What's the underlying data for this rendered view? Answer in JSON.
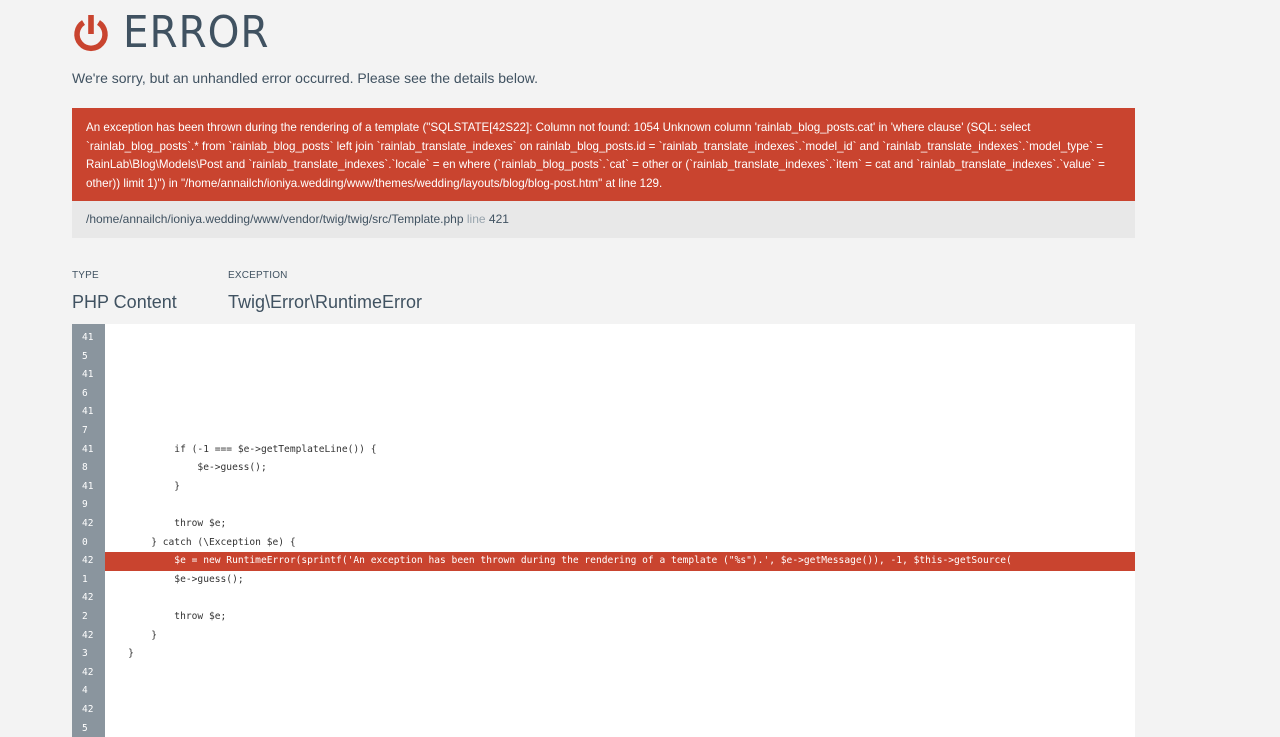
{
  "header": {
    "title": "ERROR",
    "icon": "power-icon",
    "accent_color": "#c9442f"
  },
  "subtitle": "We're sorry, but an unhandled error occurred. Please see the details below.",
  "error_message": "An exception has been thrown during the rendering of a template (\"SQLSTATE[42S22]: Column not found: 1054 Unknown column 'rainlab_blog_posts.cat' in 'where clause' (SQL: select `rainlab_blog_posts`.* from `rainlab_blog_posts` left join `rainlab_translate_indexes` on rainlab_blog_posts.id = `rainlab_translate_indexes`.`model_id` and `rainlab_translate_indexes`.`model_type` = RainLab\\Blog\\Models\\Post and `rainlab_translate_indexes`.`locale` = en where (`rainlab_blog_posts`.`cat` = other or (`rainlab_translate_indexes`.`item` = cat and `rainlab_translate_indexes`.`value` = other)) limit 1)\") in \"/home/annailch/ioniya.wedding/www/themes/wedding/layouts/blog/blog-post.htm\" at line 129.",
  "file": {
    "path": "/home/annailch/ioniya.wedding/www/vendor/twig/twig/src/Template.php",
    "line_label": "line",
    "line_number": "421"
  },
  "meta": {
    "type_label": "TYPE",
    "type_value": "PHP Content",
    "exception_label": "EXCEPTION",
    "exception_value": "Twig\\Error\\RuntimeError"
  },
  "code": {
    "gutter": [
      "41",
      "5",
      "41",
      "6",
      "41",
      "7",
      "41",
      "8",
      "41",
      "9",
      "42",
      "0",
      "42",
      "1",
      "42",
      "2",
      "42",
      "3",
      "42",
      "4",
      "42",
      "5"
    ],
    "lines": [
      "",
      "",
      "",
      "",
      "",
      "",
      "            if (-1 === $e->getTemplateLine()) {",
      "                $e->guess();",
      "            }",
      "",
      "            throw $e;",
      "        } catch (\\Exception $e) {",
      "            $e = new RuntimeError(sprintf('An exception has been thrown during the rendering of a template (\"%s\").', $e->getMessage()), -1, $this->getSource(",
      "            $e->guess();",
      "",
      "            throw $e;",
      "        }",
      "    }",
      "",
      "",
      "",
      ""
    ],
    "highlight_index": 12
  }
}
